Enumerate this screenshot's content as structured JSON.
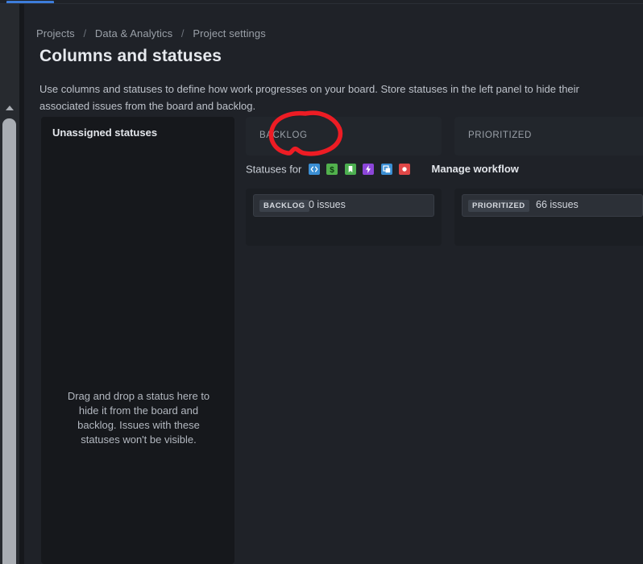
{
  "window": {
    "loading_bar_accent": "#3d7ddb",
    "background": "#1f2228"
  },
  "breadcrumb": {
    "items": [
      "Projects",
      "Data & Analytics",
      "Project settings"
    ],
    "separator": "/"
  },
  "header": {
    "title": "Columns and statuses",
    "description": "Use columns and statuses to define how work progresses on your board. Store statuses in the left panel to hide their associated issues from the board and backlog."
  },
  "unassigned_panel": {
    "title": "Unassigned statuses",
    "empty_text": "Drag and drop a status here to hide it from the board and backlog. Issues with these statuses won't be visible."
  },
  "statuses_for": {
    "label": "Statuses for",
    "manage_workflow_label": "Manage workflow",
    "project_icons": [
      {
        "name": "code-brackets-icon",
        "color": "#3b8fd4",
        "glyph": "<>"
      },
      {
        "name": "dollar-sign-icon",
        "color": "#52b14d",
        "glyph": "$"
      },
      {
        "name": "bookmark-icon",
        "color": "#4caf50",
        "glyph": "▮"
      },
      {
        "name": "lightning-bolt-icon",
        "color": "#8c46d9",
        "glyph": "⚡"
      },
      {
        "name": "copy-pages-icon",
        "color": "#3b8fd4",
        "glyph": "⧉"
      },
      {
        "name": "record-dot-icon",
        "color": "#e04747",
        "glyph": "●"
      }
    ]
  },
  "columns": [
    {
      "header_label": "BACKLOG",
      "statuses": [
        {
          "pill": "BACKLOG",
          "count": "0 issues"
        }
      ]
    },
    {
      "header_label": "PRIORITIZED",
      "statuses": [
        {
          "pill": "PRIORITIZED",
          "count": "66 issues"
        }
      ]
    }
  ],
  "annotation": {
    "shape": "hand-drawn-ellipse",
    "color": "#ed1c24",
    "target": "BACKLOG"
  }
}
